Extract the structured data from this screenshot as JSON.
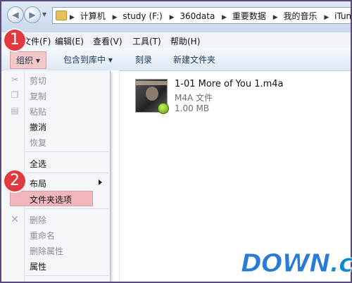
{
  "address": {
    "crumbs": [
      "计算机",
      "study (F:)",
      "360data",
      "重要数据",
      "我的音乐",
      "iTune"
    ]
  },
  "menubar": [
    "文件(F)",
    "编辑(E)",
    "查看(V)",
    "工具(T)",
    "帮助(H)"
  ],
  "toolbar": {
    "organize": "组织 ▾",
    "include": "包含到库中 ▾",
    "burn": "刻录",
    "new_folder": "新建文件夹"
  },
  "context_menu": {
    "cut": "剪切",
    "copy": "复制",
    "paste": "粘贴",
    "undo": "撤消",
    "redo": "恢复",
    "select_all": "全选",
    "layout": "布局",
    "folder_options": "文件夹选项",
    "delete": "删除",
    "rename": "重命名",
    "remove_properties": "删除属性",
    "properties": "属性"
  },
  "file": {
    "name": "1-01 More of You 1.m4a",
    "type": "M4A 文件",
    "size": "1.00 MB"
  },
  "steps": [
    "1",
    "2"
  ],
  "watermark": {
    "text": "DOWN",
    "suffix": ".cc"
  },
  "colors": {
    "highlight": "#f0b6bb",
    "step": "#e0393f"
  }
}
